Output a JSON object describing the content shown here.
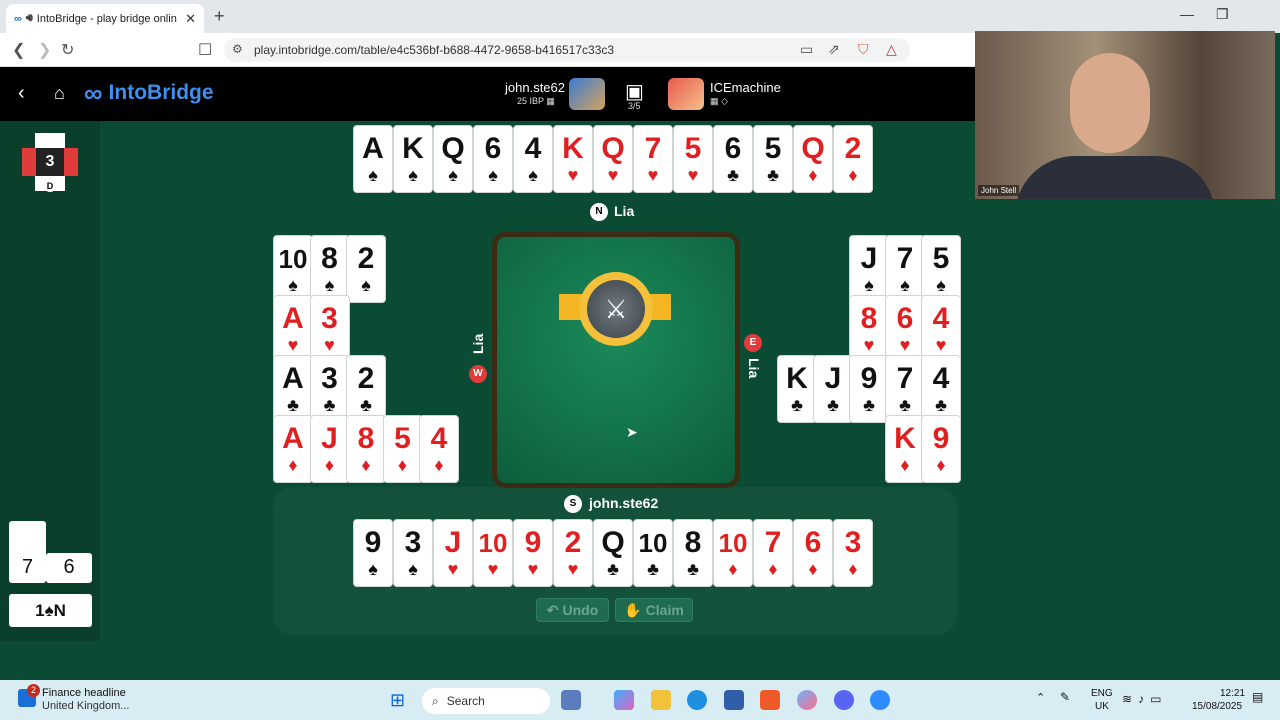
{
  "browser": {
    "tab_title": "IntoBridge - play bridge onlin",
    "tab_icon": "intobridge-logo-icon",
    "url": "play.intobridge.com/table/e4c536bf-b688-4472-9658-b416517c33c3"
  },
  "app": {
    "brand": "IntoBridge",
    "player1": {
      "name": "john.ste62",
      "rating": "25 IBP"
    },
    "round": "3/5",
    "player2": {
      "name": "ICEmachine"
    }
  },
  "video": {
    "label": "John Stell"
  },
  "scoreboard": {
    "board_number": "3",
    "dealer": "D",
    "tricks_ns": "7",
    "tricks_ew": "6",
    "contract": "1♠N"
  },
  "seats": {
    "north": {
      "letter": "N",
      "name": "Lia"
    },
    "west": {
      "letter": "W",
      "name": "Lia"
    },
    "east": {
      "letter": "E",
      "name": "Lia"
    },
    "south": {
      "letter": "S",
      "name": "john.ste62"
    }
  },
  "hands": {
    "north": [
      {
        "rank": "A",
        "suit": "♠"
      },
      {
        "rank": "K",
        "suit": "♠"
      },
      {
        "rank": "Q",
        "suit": "♠"
      },
      {
        "rank": "6",
        "suit": "♠"
      },
      {
        "rank": "4",
        "suit": "♠"
      },
      {
        "rank": "K",
        "suit": "♥"
      },
      {
        "rank": "Q",
        "suit": "♥"
      },
      {
        "rank": "7",
        "suit": "♥"
      },
      {
        "rank": "5",
        "suit": "♥"
      },
      {
        "rank": "6",
        "suit": "♣"
      },
      {
        "rank": "5",
        "suit": "♣"
      },
      {
        "rank": "Q",
        "suit": "♦"
      },
      {
        "rank": "2",
        "suit": "♦"
      }
    ],
    "west": [
      [
        {
          "rank": "10",
          "suit": "♠"
        },
        {
          "rank": "8",
          "suit": "♠"
        },
        {
          "rank": "2",
          "suit": "♠"
        }
      ],
      [
        {
          "rank": "A",
          "suit": "♥"
        },
        {
          "rank": "3",
          "suit": "♥"
        }
      ],
      [
        {
          "rank": "A",
          "suit": "♣"
        },
        {
          "rank": "3",
          "suit": "♣"
        },
        {
          "rank": "2",
          "suit": "♣"
        }
      ],
      [
        {
          "rank": "A",
          "suit": "♦"
        },
        {
          "rank": "J",
          "suit": "♦"
        },
        {
          "rank": "8",
          "suit": "♦"
        },
        {
          "rank": "5",
          "suit": "♦"
        },
        {
          "rank": "4",
          "suit": "♦"
        }
      ]
    ],
    "east": [
      [
        {
          "rank": "J",
          "suit": "♠"
        },
        {
          "rank": "7",
          "suit": "♠"
        },
        {
          "rank": "5",
          "suit": "♠"
        }
      ],
      [
        {
          "rank": "8",
          "suit": "♥"
        },
        {
          "rank": "6",
          "suit": "♥"
        },
        {
          "rank": "4",
          "suit": "♥"
        }
      ],
      [
        {
          "rank": "K",
          "suit": "♣"
        },
        {
          "rank": "J",
          "suit": "♣"
        },
        {
          "rank": "9",
          "suit": "♣"
        },
        {
          "rank": "7",
          "suit": "♣"
        },
        {
          "rank": "4",
          "suit": "♣"
        }
      ],
      [
        {
          "rank": "K",
          "suit": "♦"
        },
        {
          "rank": "9",
          "suit": "♦"
        }
      ]
    ],
    "south": [
      {
        "rank": "9",
        "suit": "♠"
      },
      {
        "rank": "3",
        "suit": "♠"
      },
      {
        "rank": "J",
        "suit": "♥"
      },
      {
        "rank": "10",
        "suit": "♥"
      },
      {
        "rank": "9",
        "suit": "♥"
      },
      {
        "rank": "2",
        "suit": "♥"
      },
      {
        "rank": "Q",
        "suit": "♣"
      },
      {
        "rank": "10",
        "suit": "♣"
      },
      {
        "rank": "8",
        "suit": "♣"
      },
      {
        "rank": "10",
        "suit": "♦"
      },
      {
        "rank": "7",
        "suit": "♦"
      },
      {
        "rank": "6",
        "suit": "♦"
      },
      {
        "rank": "3",
        "suit": "♦"
      }
    ]
  },
  "actions": {
    "undo": "Undo",
    "claim": "Claim"
  },
  "taskbar": {
    "news_count": "2",
    "news_headline": "Finance headline",
    "news_sub": "United Kingdom...",
    "search": "Search",
    "lang_top": "ENG",
    "lang_bottom": "UK",
    "time": "12:21",
    "date": "15/08/2025"
  },
  "colors": {
    "felt": "#0b4a33",
    "red_suit": "#e02020",
    "vulnerable": "#e03c3c",
    "brand": "#3d8ff0"
  }
}
